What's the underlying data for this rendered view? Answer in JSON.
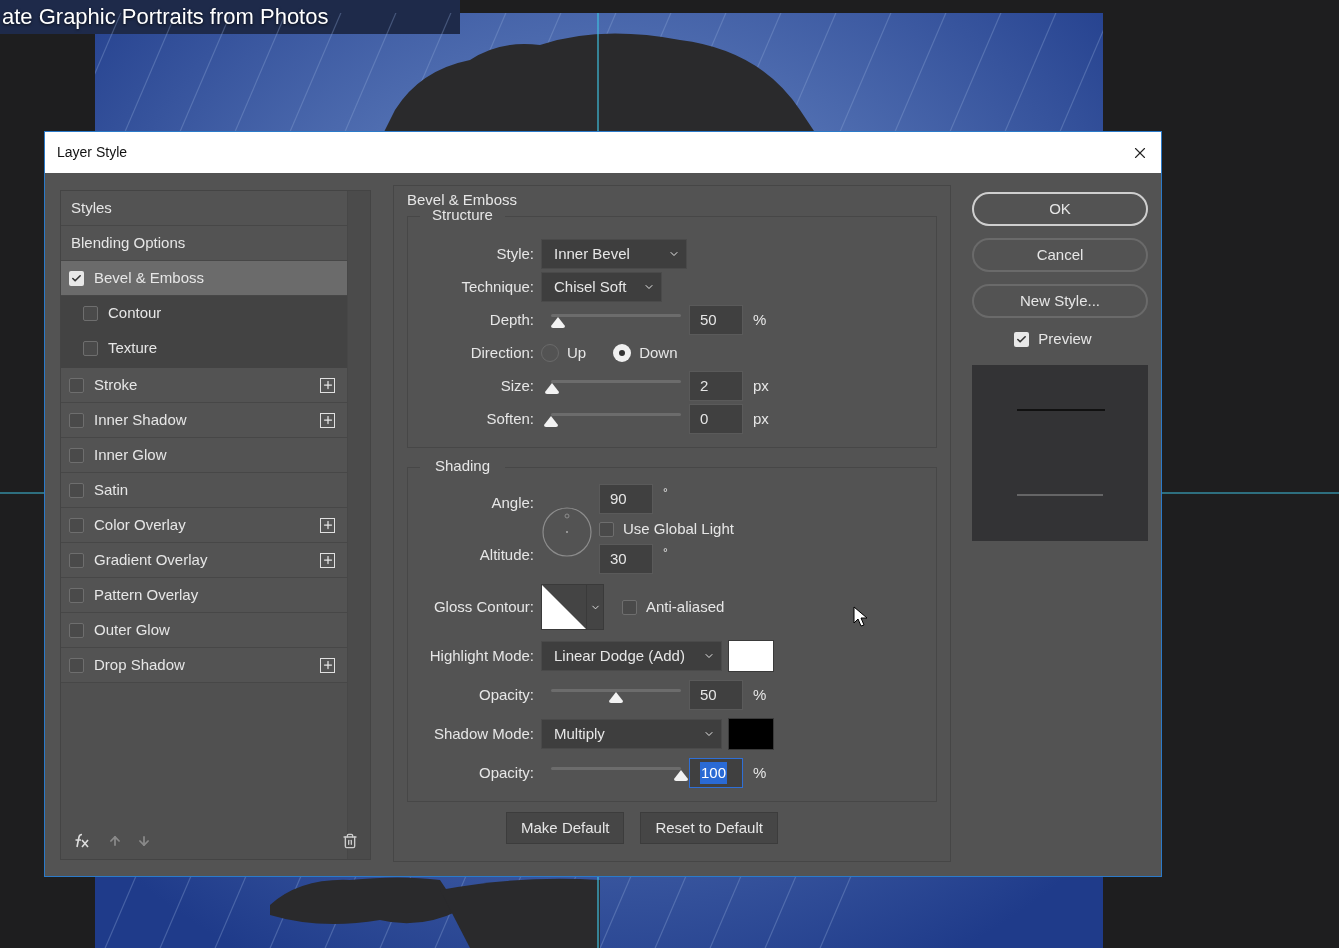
{
  "document_title": "ate Graphic Portraits from Photos",
  "dialog": {
    "title": "Layer Style",
    "style_list": [
      {
        "label": "Styles",
        "kind": "header",
        "selected": false
      },
      {
        "label": "Blending Options",
        "kind": "header",
        "selected": false
      },
      {
        "label": "Bevel & Emboss",
        "kind": "effect",
        "checked": true,
        "selected": true,
        "add": false,
        "children": [
          {
            "label": "Contour",
            "checked": false
          },
          {
            "label": "Texture",
            "checked": false
          }
        ]
      },
      {
        "label": "Stroke",
        "kind": "effect",
        "checked": false,
        "selected": false,
        "add": true
      },
      {
        "label": "Inner Shadow",
        "kind": "effect",
        "checked": false,
        "selected": false,
        "add": true
      },
      {
        "label": "Inner Glow",
        "kind": "effect",
        "checked": false,
        "selected": false,
        "add": false
      },
      {
        "label": "Satin",
        "kind": "effect",
        "checked": false,
        "selected": false,
        "add": false
      },
      {
        "label": "Color Overlay",
        "kind": "effect",
        "checked": false,
        "selected": false,
        "add": true
      },
      {
        "label": "Gradient Overlay",
        "kind": "effect",
        "checked": false,
        "selected": false,
        "add": true
      },
      {
        "label": "Pattern Overlay",
        "kind": "effect",
        "checked": false,
        "selected": false,
        "add": false
      },
      {
        "label": "Outer Glow",
        "kind": "effect",
        "checked": false,
        "selected": false,
        "add": false
      },
      {
        "label": "Drop Shadow",
        "kind": "effect",
        "checked": false,
        "selected": false,
        "add": true
      }
    ],
    "panel": {
      "title": "Bevel & Emboss",
      "structure": {
        "title": "Structure",
        "style": {
          "label": "Style:",
          "value": "Inner Bevel"
        },
        "technique": {
          "label": "Technique:",
          "value": "Chisel Soft"
        },
        "depth": {
          "label": "Depth:",
          "level": 0.05,
          "value": "50",
          "unit": "%"
        },
        "direction": {
          "label": "Direction:",
          "options": [
            {
              "label": "Up",
              "selected": false
            },
            {
              "label": "Down",
              "selected": true
            }
          ]
        },
        "size": {
          "label": "Size:",
          "level": 0.01,
          "value": "2",
          "unit": "px"
        },
        "soften": {
          "label": "Soften:",
          "level": 0,
          "value": "0",
          "unit": "px"
        }
      },
      "shading": {
        "title": "Shading",
        "angle": {
          "label": "Angle:",
          "value": "90",
          "unit": "°"
        },
        "use_global_light": {
          "label": "Use Global Light",
          "checked": false
        },
        "altitude": {
          "label": "Altitude:",
          "value": "30",
          "unit": "°"
        },
        "gloss_contour": {
          "label": "Gloss Contour:"
        },
        "anti_aliased": {
          "label": "Anti-aliased",
          "checked": false
        },
        "highlight_mode": {
          "label": "Highlight Mode:",
          "value": "Linear Dodge (Add)",
          "color": "#ffffff"
        },
        "highlight_opacity": {
          "label": "Opacity:",
          "level": 0.5,
          "value": "50",
          "unit": "%",
          "focused": false
        },
        "shadow_mode": {
          "label": "Shadow Mode:",
          "value": "Multiply",
          "color": "#000000"
        },
        "shadow_opacity": {
          "label": "Opacity:",
          "level": 1,
          "value": "100",
          "unit": "%",
          "focused": true
        }
      },
      "buttons": [
        {
          "label": "Make Default"
        },
        {
          "label": "Reset to Default"
        }
      ]
    },
    "actions": [
      {
        "label": "OK",
        "default": true
      },
      {
        "label": "Cancel",
        "default": false
      },
      {
        "label": "New Style...",
        "default": false
      }
    ],
    "preview": {
      "label": "Preview",
      "checked": true
    }
  }
}
